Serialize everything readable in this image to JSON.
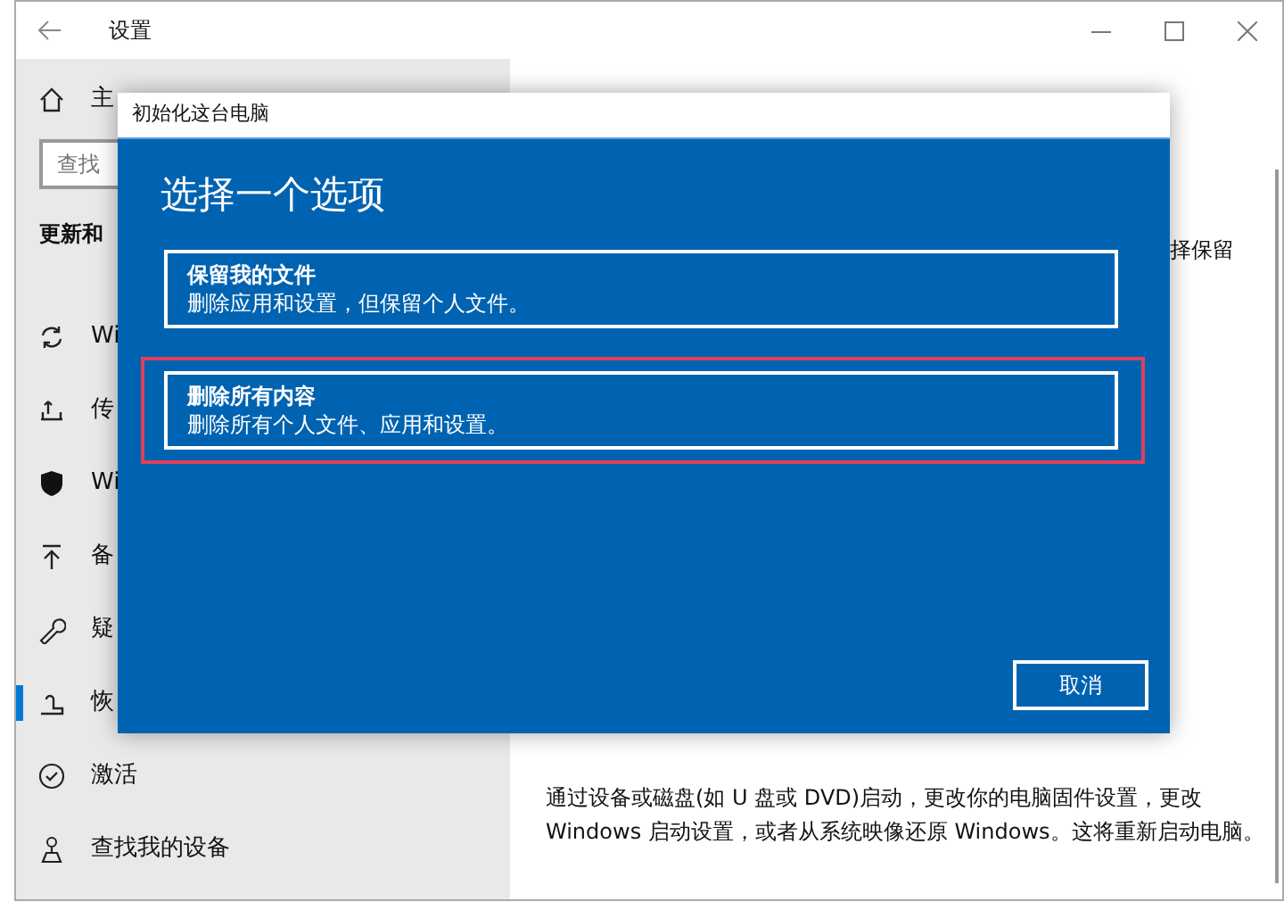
{
  "window": {
    "title": "设置"
  },
  "sidebar": {
    "home": "主",
    "search": {
      "placeholder": "查找"
    },
    "section": "更新和",
    "items": [
      {
        "label": "Wi",
        "selected": false
      },
      {
        "label": "传",
        "selected": false
      },
      {
        "label": "Wi",
        "selected": false
      },
      {
        "label": "备",
        "selected": false
      },
      {
        "label": "疑",
        "selected": false
      },
      {
        "label": "恢",
        "selected": true
      },
      {
        "label": "激活",
        "selected": false
      },
      {
        "label": "查找我的设备",
        "selected": false
      }
    ]
  },
  "main": {
    "partial_text": "择保留",
    "description": "通过设备或磁盘(如 U 盘或 DVD)启动，更改你的电脑固件设置，更改 Windows 启动设置，或者从系统映像还原 Windows。这将重新启动电脑。"
  },
  "dialog": {
    "title": "初始化这台电脑",
    "heading": "选择一个选项",
    "options": [
      {
        "title": "保留我的文件",
        "description": "删除应用和设置，但保留个人文件。",
        "highlighted": false
      },
      {
        "title": "删除所有内容",
        "description": "删除所有个人文件、应用和设置。",
        "highlighted": true
      }
    ],
    "cancel": "取消"
  }
}
